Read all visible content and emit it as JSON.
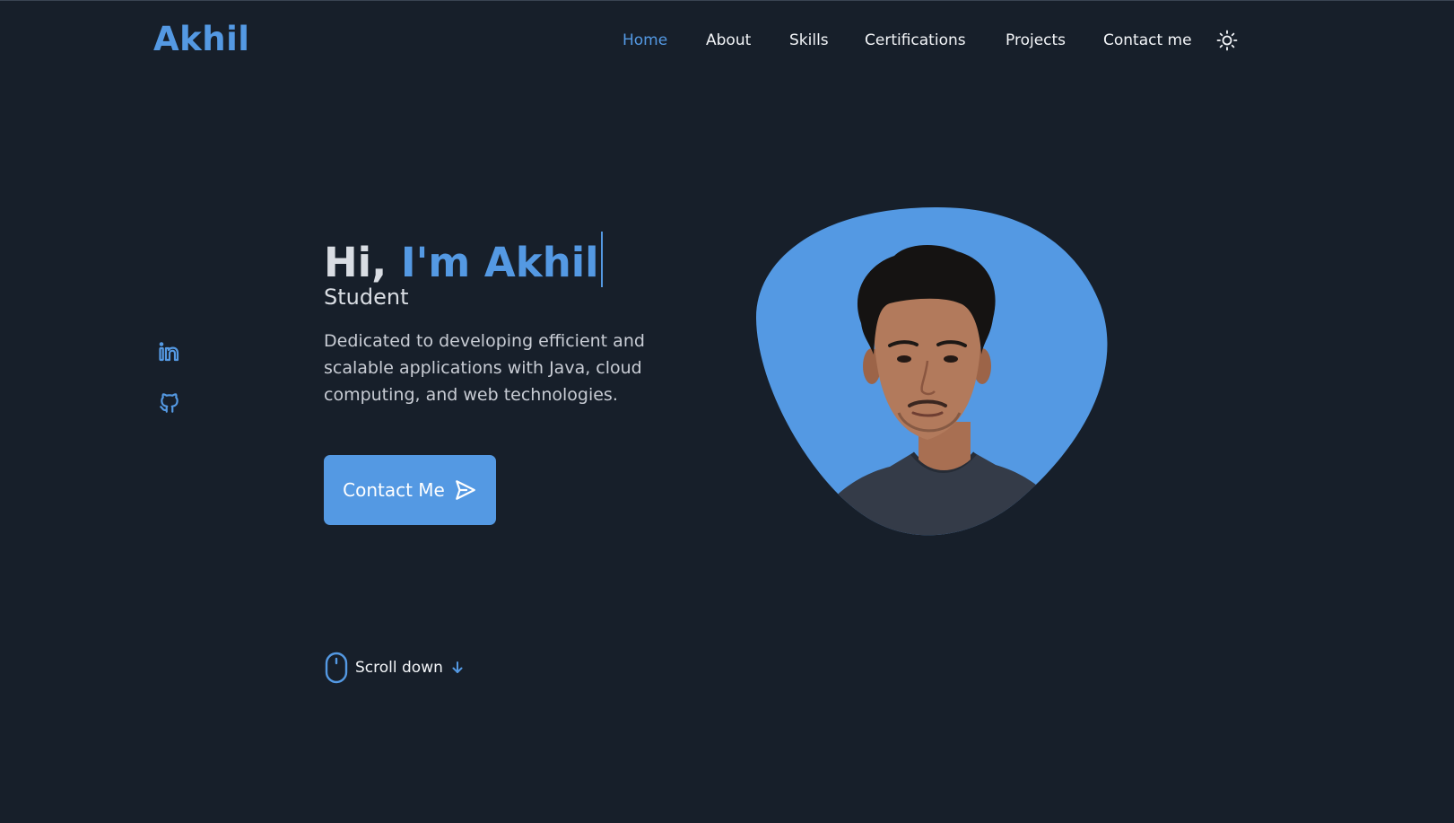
{
  "header": {
    "logo": "Akhil",
    "nav": [
      {
        "label": "Home",
        "active": true
      },
      {
        "label": "About",
        "active": false
      },
      {
        "label": "Skills",
        "active": false
      },
      {
        "label": "Certifications",
        "active": false
      },
      {
        "label": "Projects",
        "active": false
      },
      {
        "label": "Contact me",
        "active": false
      }
    ],
    "theme_toggle_icon": "sun-icon"
  },
  "social": [
    {
      "icon": "linkedin-icon"
    },
    {
      "icon": "github-icon"
    }
  ],
  "hero": {
    "greeting": "Hi,",
    "name": "I'm Akhil",
    "subtitle": "Student",
    "description": "Dedicated to developing efficient and scalable applications with Java, cloud computing, and web technologies.",
    "button_label": "Contact Me",
    "button_icon": "send-icon"
  },
  "scroll": {
    "label": "Scroll down",
    "mouse_icon": "mouse-icon",
    "arrow_icon": "arrow-down-icon"
  },
  "colors": {
    "background": "#171f2a",
    "accent": "#5499e3",
    "text": "#f3f5f8"
  }
}
